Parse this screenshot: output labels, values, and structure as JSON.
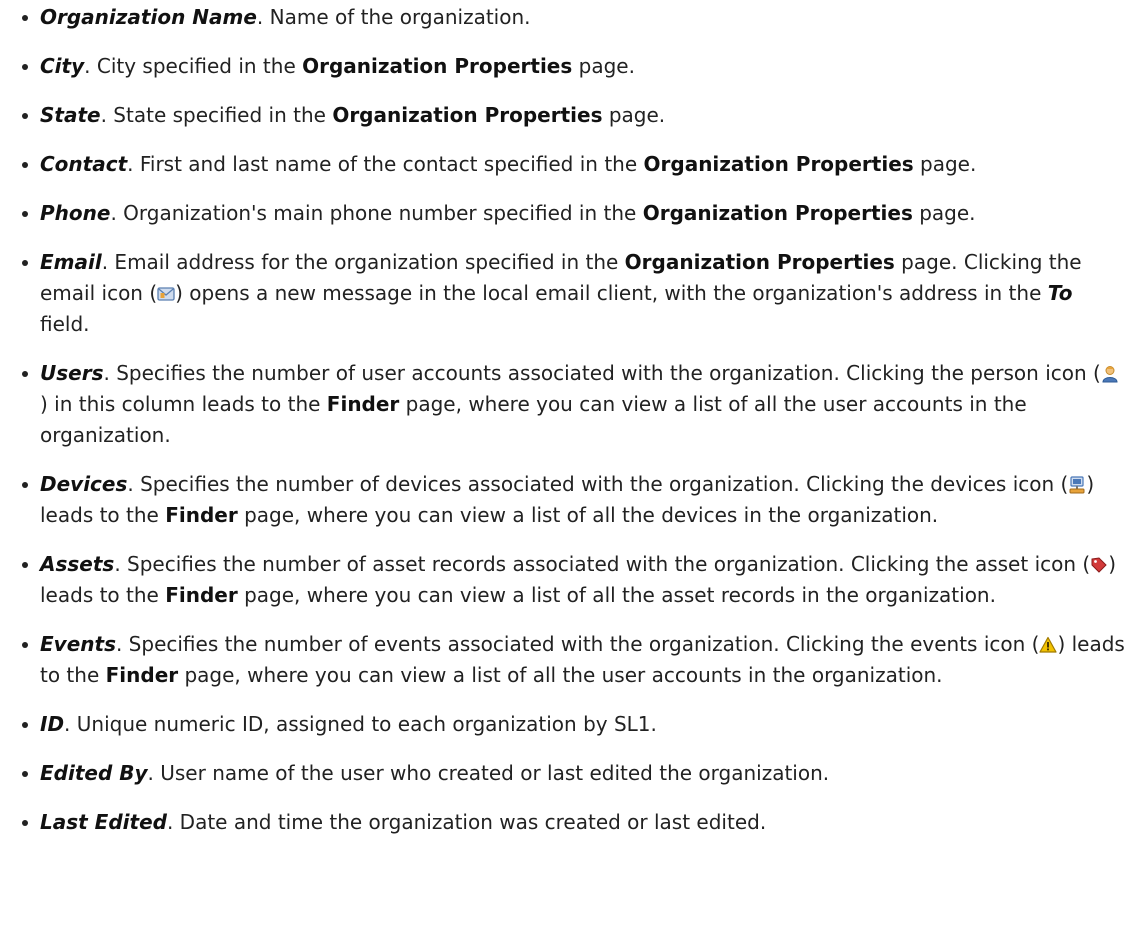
{
  "items": [
    {
      "term": "Organization Name",
      "text": ". Name of the organization."
    },
    {
      "term": "City",
      "t1": ". City specified in the ",
      "b1": "Organization Properties",
      "t2": " page."
    },
    {
      "term": "State",
      "t1": ". State specified in the ",
      "b1": "Organization Properties",
      "t2": " page."
    },
    {
      "term": "Contact",
      "t1": ". First and last name of the contact specified in the ",
      "b1": "Organization Properties",
      "t2": " page."
    },
    {
      "term": "Phone",
      "t1": ". Organization's main phone number specified in the ",
      "b1": "Organization Properties",
      "t2": " page."
    },
    {
      "term": "Email",
      "t1": ". Email address for the organization specified in the ",
      "b1": "Organization Properties",
      "t2": " page. Clicking the email icon (",
      "t3": ") opens a new message in the local email client, with the organization's address in the ",
      "b2": "To",
      "t4": " field."
    },
    {
      "term": "Users",
      "t1": ". Specifies the number of user accounts associated with the organization. Clicking the person icon (",
      "t2": ") in this column leads to the ",
      "b1": "Finder",
      "t3": " page, where you can view a list of all the user accounts in the organization."
    },
    {
      "term": "Devices",
      "t1": ". Specifies the number of devices associated with the organization. Clicking the devices icon (",
      "t2": ") leads to the ",
      "b1": "Finder",
      "t3": " page, where you can view a list of all the devices in the organization."
    },
    {
      "term": "Assets",
      "t1": ". Specifies the number of asset records associated with the organization. Clicking the asset icon (",
      "t2": ") leads to the ",
      "b1": "Finder",
      "t3": " page, where you can view a list of all the asset records in the organization."
    },
    {
      "term": "Events",
      "t1": ". Specifies the number of events associated with the organization. Clicking the events icon (",
      "t2": ") leads to the ",
      "b1": "Finder",
      "t3": " page, where you can view a list of all the user accounts in the organization."
    },
    {
      "term": "ID",
      "text": ". Unique numeric ID, assigned to each organization by SL1."
    },
    {
      "term": "Edited By",
      "text": ". User name of the user who created or last edited the organization."
    },
    {
      "term": "Last Edited",
      "text": ". Date and time the organization was created or last edited."
    }
  ],
  "icons": {
    "email": "email-icon",
    "person": "person-icon",
    "devices": "devices-icon",
    "asset": "asset-tag-icon",
    "events": "warning-icon"
  },
  "colors": {
    "text": "#222222",
    "email_icon": "#5a7fb0",
    "person_icon": "#e8a33a",
    "devices_icon": "#4a78b8",
    "asset_icon": "#d23a3a",
    "events_icon": "#f2c200"
  }
}
